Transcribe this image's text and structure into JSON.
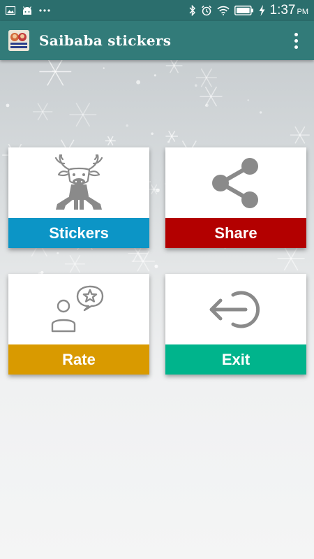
{
  "status_bar": {
    "time": "1:37",
    "ampm": "PM"
  },
  "app_bar": {
    "title": "Saibaba stickers",
    "logo_text": "Sai baba Stickers"
  },
  "tiles": [
    {
      "label": "Stickers",
      "icon": "moose-icon",
      "color": "#0c95c6"
    },
    {
      "label": "Share",
      "icon": "share-icon",
      "color": "#b30000"
    },
    {
      "label": "Rate",
      "icon": "rate-icon",
      "color": "#d99a00"
    },
    {
      "label": "Exit",
      "icon": "exit-icon",
      "color": "#00b48c"
    }
  ],
  "colors": {
    "status_bar": "#2b6e6d",
    "app_bar": "#327b79",
    "icon_gray": "#8a8a8a"
  }
}
